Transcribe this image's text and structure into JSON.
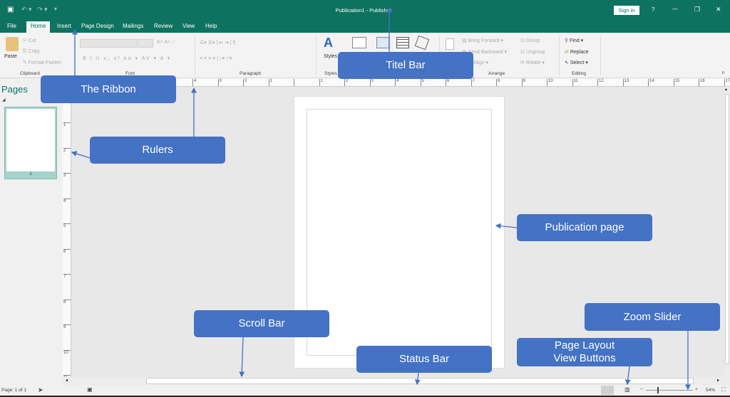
{
  "window": {
    "title": "Publication1  -  Publisher",
    "sign_in": "Sign in",
    "help": "?",
    "minimize": "—",
    "restore": "❐",
    "close": "✕"
  },
  "tabs": [
    "File",
    "Home",
    "Insert",
    "Page Design",
    "Mailings",
    "Review",
    "View",
    "Help"
  ],
  "active_tab": "Home",
  "ribbon": {
    "clipboard": {
      "paste": "Paste",
      "cut": "Cut",
      "copy": "Copy",
      "format_painter": "Format Painter",
      "label": "Clipboard"
    },
    "font": {
      "label": "Font",
      "buttons": [
        "B",
        "I",
        "U",
        "x₂",
        "x²",
        "Aa ▾",
        "AV ▾",
        "A ▾"
      ]
    },
    "paragraph": {
      "label": "Paragraph"
    },
    "styles": {
      "label": "Styles",
      "button": "Styles"
    },
    "arrange": {
      "label": "Arrange",
      "bring_forward": "Bring Forward",
      "send_backward": "Send Backward",
      "align": "Align",
      "group": "Group",
      "ungroup": "Ungroup",
      "rotate": "Rotate"
    },
    "editing": {
      "label": "Editing",
      "find": "Find",
      "replace": "Replace",
      "select": "Select"
    }
  },
  "pages_pane": {
    "title": "Pages",
    "thumb_number": "1"
  },
  "ruler": {
    "h_ticks": [
      "4",
      "3",
      "2",
      "1",
      "",
      "1",
      "2",
      "3",
      "4",
      "5",
      "6",
      "7",
      "8",
      "9",
      "10",
      "11",
      "12",
      "13",
      "14",
      "15",
      "16",
      "17"
    ],
    "v_ticks": [
      "1",
      "2",
      "3",
      "4",
      "5",
      "6",
      "7",
      "8",
      "9",
      "10",
      "11"
    ]
  },
  "status": {
    "page": "Page: 1 of 1",
    "zoom": "54%",
    "zoom_level": 54
  },
  "callouts": {
    "ribbon": "The Ribbon",
    "title_bar": "Titel Bar",
    "rulers": "Rulers",
    "publication_page": "Publication page",
    "scroll_bar": "Scroll Bar",
    "status_bar": "Status Bar",
    "view_buttons": "Page Layout View Buttons",
    "zoom_slider": "Zoom Slider"
  },
  "colors": {
    "title_green": "#0e7261",
    "callout_blue": "#4472c4"
  }
}
